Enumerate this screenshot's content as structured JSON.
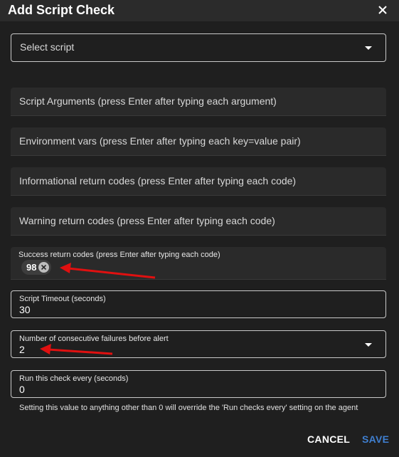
{
  "dialog": {
    "title": "Add Script Check",
    "close_icon": "close-icon"
  },
  "fields": {
    "script_select": {
      "placeholder": "Select script"
    },
    "script_arguments": {
      "placeholder": "Script Arguments (press Enter after typing each argument)"
    },
    "env_vars": {
      "placeholder": "Environment vars (press Enter after typing each key=value pair)"
    },
    "info_codes": {
      "placeholder": "Informational return codes (press Enter after typing each code)"
    },
    "warning_codes": {
      "placeholder": "Warning return codes (press Enter after typing each code)"
    },
    "success_codes": {
      "label": "Success return codes (press Enter after typing each code)",
      "chips": [
        "98"
      ]
    },
    "timeout": {
      "label": "Script Timeout (seconds)",
      "value": "30"
    },
    "fails_before_alert": {
      "label": "Number of consecutive failures before alert",
      "value": "2"
    },
    "run_interval": {
      "label": "Run this check every (seconds)",
      "value": "0",
      "hint": "Setting this value to anything other than 0 will override the 'Run checks every' setting on the agent"
    }
  },
  "actions": {
    "cancel_label": "CANCEL",
    "save_label": "SAVE"
  },
  "colors": {
    "background": "#1f1f1f",
    "save_accent": "#3f7fd0",
    "annotation_arrow": "#e01010"
  }
}
